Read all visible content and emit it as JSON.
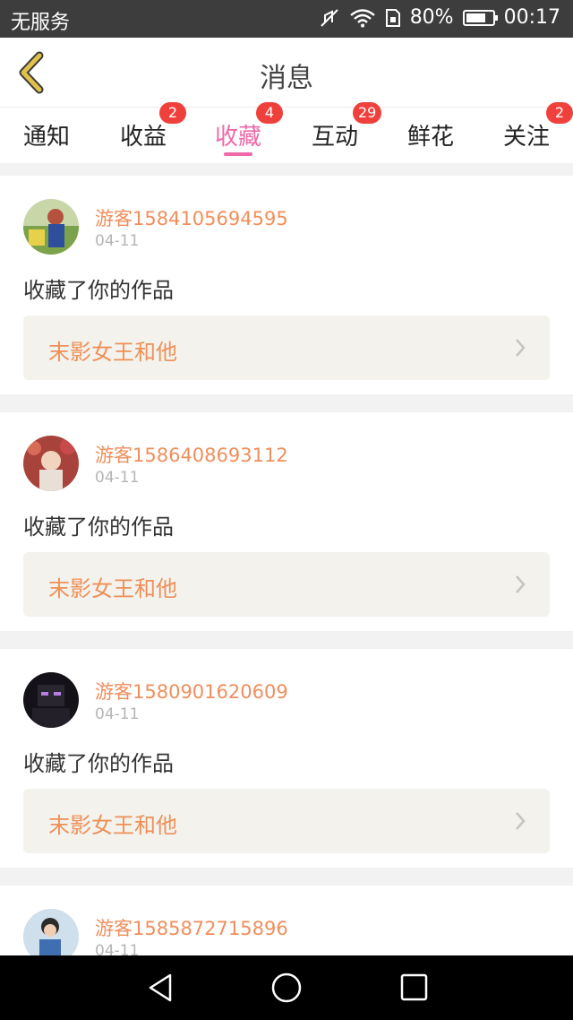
{
  "status_bar": {
    "carrier": "无服务",
    "battery": "80%",
    "battery_level": 0.8,
    "time": "00:17",
    "icons": [
      "mute-icon",
      "wifi-icon",
      "sim-icon",
      "battery-icon"
    ]
  },
  "header": {
    "title": "消息",
    "back_icon": "chevron-left-icon",
    "accent_color": "#d9b23a"
  },
  "tabs": [
    {
      "label": "通知",
      "badge": ""
    },
    {
      "label": "收益",
      "badge": "2"
    },
    {
      "label": "收藏",
      "badge": "4",
      "active": true
    },
    {
      "label": "互动",
      "badge": "29"
    },
    {
      "label": "鲜花",
      "badge": ""
    },
    {
      "label": "关注",
      "badge": "2"
    }
  ],
  "colors": {
    "active_tab": "#ee6aa7",
    "username": "#f08e5c",
    "badge": "#f0403c",
    "work_title": "#ee9058"
  },
  "items": [
    {
      "user": "游客1584105694595",
      "date": "04-11",
      "action": "收藏了你的作品",
      "work": "末影女王和他"
    },
    {
      "user": "游客1586408693112",
      "date": "04-11",
      "action": "收藏了你的作品",
      "work": "末影女王和他"
    },
    {
      "user": "游客1580901620609",
      "date": "04-11",
      "action": "收藏了你的作品",
      "work": "末影女王和他"
    },
    {
      "user": "游客1585872715896",
      "date": "04-11",
      "action": "",
      "work": ""
    }
  ],
  "nav_bar": {
    "icons": [
      "back-triangle-icon",
      "home-circle-icon",
      "recents-square-icon"
    ]
  }
}
